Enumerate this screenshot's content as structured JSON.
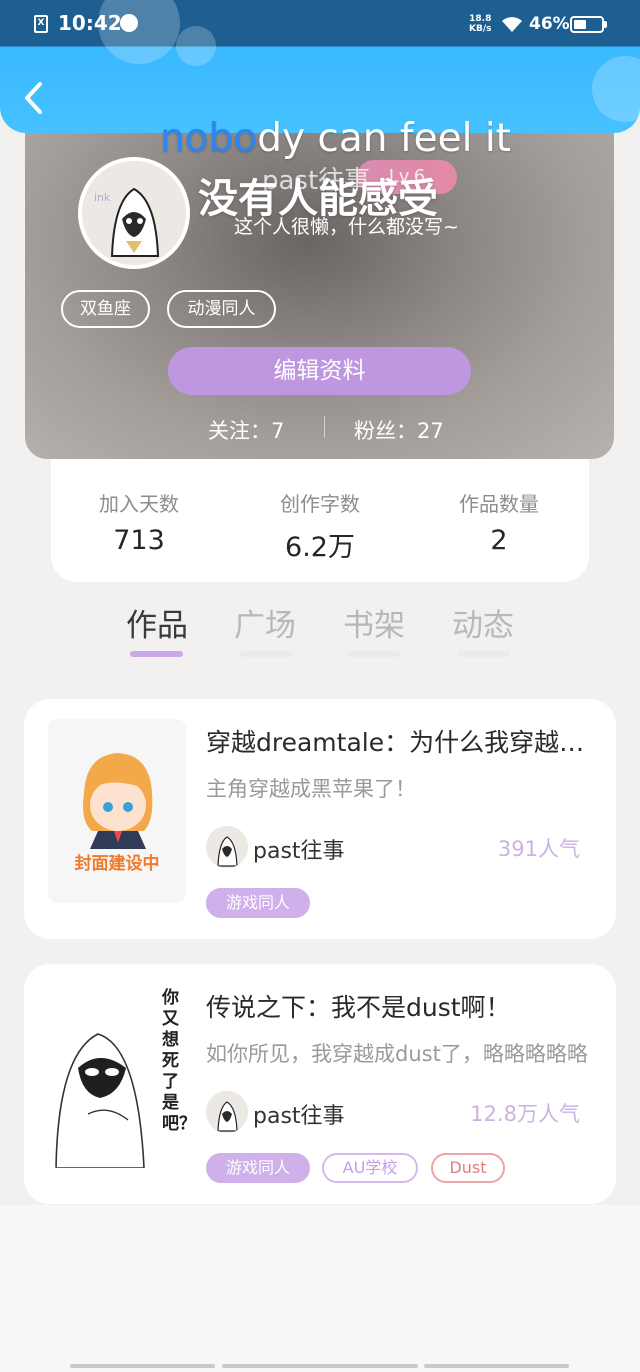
{
  "status_bar": {
    "time": "10:42",
    "sim_glyph": "X",
    "net_speed_line1": "18.8",
    "net_speed_line2": "KB/s",
    "battery": "46%"
  },
  "profile": {
    "overlay_title_highlight": "nobo",
    "overlay_title_rest": "dy can feel it",
    "nickname": "past往事",
    "level": "Lv.6",
    "headline": "没有人能感受",
    "bio": "这个人很懒，什么都没写~",
    "tags": [
      "双鱼座",
      "动漫同人"
    ],
    "edit_button": "编辑资料",
    "following_label": "关注：",
    "following": "7",
    "followers_label": "粉丝：",
    "followers": "27"
  },
  "stats": [
    {
      "label": "加入天数",
      "value": "713"
    },
    {
      "label": "创作字数",
      "value": "6.2万"
    },
    {
      "label": "作品数量",
      "value": "2"
    }
  ],
  "tabs": [
    "作品",
    "广场",
    "书架",
    "动态"
  ],
  "active_tab": "作品",
  "works": [
    {
      "title": "穿越dreamtale：为什么我穿越成了黑苹果",
      "description": "主角穿越成黑苹果了！",
      "author": "past往事",
      "popularity": "391人气",
      "cover_text": "封面建设中",
      "tags": [
        "游戏同人"
      ]
    },
    {
      "title": "传说之下：我不是dust啊！",
      "description": "如你所见，我穿越成dust了，略略略略略",
      "author": "past往事",
      "popularity": "12.8万人气",
      "cover_text": "你又想死了是吧？",
      "tags": [
        "游戏同人",
        "AU学校",
        "Dust"
      ]
    }
  ],
  "colors": {
    "accent_purple": "#bf97e0",
    "header_blue": "#3ab8ff",
    "popularity": "#cbb2e2",
    "tag_red": "#e07c7c"
  },
  "icons": [
    "back-arrow-icon",
    "wifi-icon",
    "battery-icon",
    "sim-icon",
    "fire-icon"
  ]
}
